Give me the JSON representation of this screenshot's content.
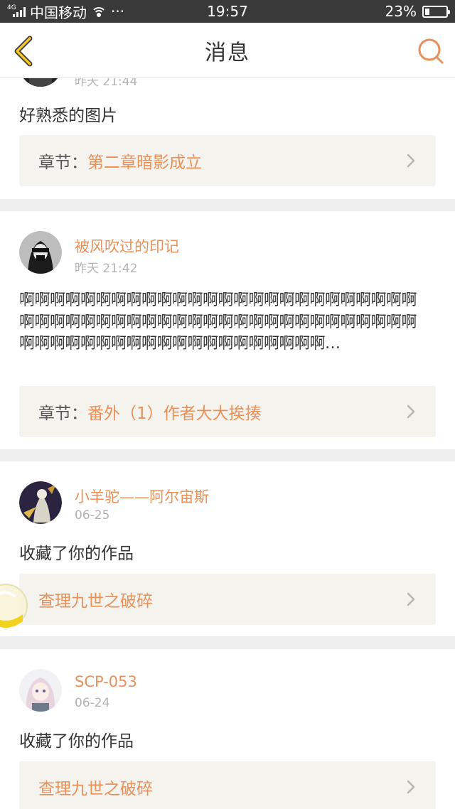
{
  "status_bar": {
    "network_type": "4G",
    "carrier": "中国移动",
    "more": "···",
    "time": "19:57",
    "battery": "23%"
  },
  "nav": {
    "title": "消息",
    "accent_color": "#e8915a"
  },
  "messages": [
    {
      "username": "",
      "time": "昨天 21:44",
      "text": "好熟悉的图片",
      "chapter_label": "章节：",
      "chapter_title": "第二章暗影成立"
    },
    {
      "username": "被风吹过的印记",
      "time": "昨天 21:42",
      "text": "啊啊啊啊啊啊啊啊啊啊啊啊啊啊啊啊啊啊啊啊啊啊啊啊啊啊啊啊啊啊啊啊啊啊啊啊啊啊啊啊啊啊啊啊啊啊啊啊啊啊啊啊啊啊啊啊啊啊啊啊啊啊啊啊啊啊啊啊啊啊啊啊…",
      "chapter_label": "章节：",
      "chapter_title": "番外（1）作者大大挨揍"
    },
    {
      "username": "小羊驼——阿尔宙斯",
      "time": "06-25",
      "text": "收藏了你的作品",
      "work_title": "查理九世之破碎"
    },
    {
      "username": "SCP-053",
      "time": "06-24",
      "text": "收藏了你的作品",
      "work_title": "查理九世之破碎"
    }
  ]
}
